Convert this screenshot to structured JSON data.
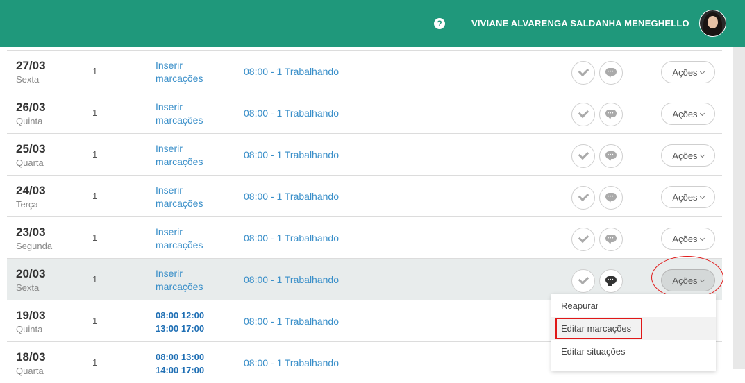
{
  "header": {
    "user_name": "VIVIANE ALVARENGA SALDANHA MENEGHELLO",
    "help_symbol": "?"
  },
  "rows": [
    {
      "date": "27/03",
      "weekday": "Sexta",
      "count": "1",
      "ins1": "Inserir",
      "ins2": "marcações",
      "schedule": "08:00 - 1 Trabalhando",
      "action": "Ações"
    },
    {
      "date": "26/03",
      "weekday": "Quinta",
      "count": "1",
      "ins1": "Inserir",
      "ins2": "marcações",
      "schedule": "08:00 - 1 Trabalhando",
      "action": "Ações"
    },
    {
      "date": "25/03",
      "weekday": "Quarta",
      "count": "1",
      "ins1": "Inserir",
      "ins2": "marcações",
      "schedule": "08:00 - 1 Trabalhando",
      "action": "Ações"
    },
    {
      "date": "24/03",
      "weekday": "Terça",
      "count": "1",
      "ins1": "Inserir",
      "ins2": "marcações",
      "schedule": "08:00 - 1 Trabalhando",
      "action": "Ações"
    },
    {
      "date": "23/03",
      "weekday": "Segunda",
      "count": "1",
      "ins1": "Inserir",
      "ins2": "marcações",
      "schedule": "08:00 - 1 Trabalhando",
      "action": "Ações"
    },
    {
      "date": "20/03",
      "weekday": "Sexta",
      "count": "1",
      "ins1": "Inserir",
      "ins2": "marcações",
      "schedule": "08:00 - 1 Trabalhando",
      "action": "Ações"
    },
    {
      "date": "19/03",
      "weekday": "Quinta",
      "count": "1",
      "ins1": "08:00 12:00",
      "ins2": "13:00 17:00",
      "schedule": "08:00 - 1 Trabalhando"
    },
    {
      "date": "18/03",
      "weekday": "Quarta",
      "count": "1",
      "ins1": "08:00 13:00",
      "ins2": "14:00 17:00",
      "schedule": "08:00 - 1 Trabalhando"
    }
  ],
  "dropdown": {
    "items": [
      "Reapurar",
      "Editar marcações",
      "Editar situações"
    ]
  },
  "colors": {
    "header": "#1f987b",
    "link": "#3a8fc9",
    "highlight": "#e01818"
  }
}
